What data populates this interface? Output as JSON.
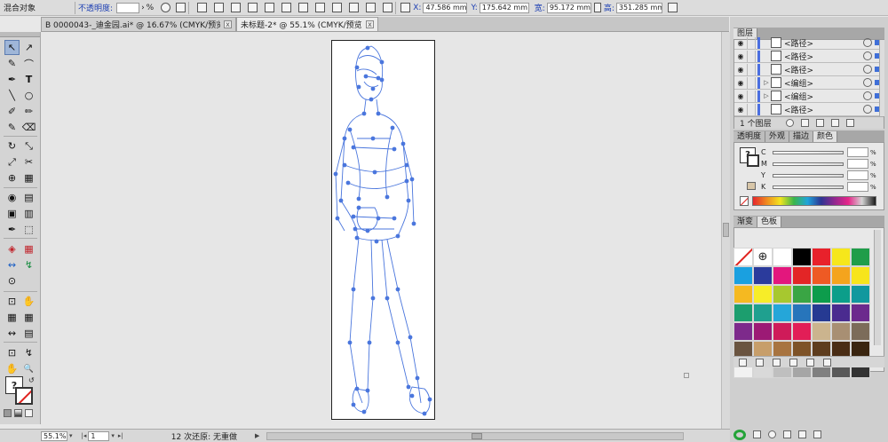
{
  "control_bar": {
    "object_type": "混合对象",
    "opacity_label": "不透明度:",
    "opacity_value": "",
    "opacity_unit": "%",
    "x_label": "X:",
    "x_value": "47.586 mm",
    "y_label": "Y:",
    "y_value": "175.642 mm",
    "w_label": "宽:",
    "w_value": "95.172 mm",
    "h_label": "高:",
    "h_value": "351.285 mm"
  },
  "tabs": [
    {
      "label": "B 0000043-_迪金园.ai* @ 16.67% (CMYK/预览)",
      "close": "x"
    },
    {
      "label": "未标题-2* @ 55.1% (CMYK/预览)",
      "close": "x"
    }
  ],
  "tools": [
    "↖",
    "↗",
    "✎",
    "⌒",
    "✒",
    "T",
    "╲",
    "○",
    "✐",
    "✏",
    "✎",
    "⌫",
    "↻",
    "⤡",
    "⤢",
    "✂",
    "⊕",
    "▦",
    "◉",
    "▤",
    "▣",
    "▥",
    "✒",
    "⬚",
    "◈",
    "▦",
    "↭",
    "↯",
    "⊙",
    "⊡",
    "✋",
    "🔍"
  ],
  "layers_panel": {
    "title": "图层",
    "rows": [
      {
        "name": "<路径>",
        "twisty": ""
      },
      {
        "name": "<路径>",
        "twisty": ""
      },
      {
        "name": "<路径>",
        "twisty": ""
      },
      {
        "name": "<编组>",
        "twisty": "▷"
      },
      {
        "name": "<编组>",
        "twisty": "▷"
      },
      {
        "name": "<路径>",
        "twisty": ""
      }
    ],
    "count_label": "1 个图层"
  },
  "color_panel": {
    "tabs": [
      "透明度",
      "外观",
      "描边",
      "颜色"
    ],
    "active_tab": "颜色",
    "channels": [
      {
        "label": "C",
        "value": "",
        "unit": "%"
      },
      {
        "label": "M",
        "value": "",
        "unit": "%"
      },
      {
        "label": "Y",
        "value": "",
        "unit": "%"
      },
      {
        "label": "K",
        "value": "",
        "unit": "%"
      }
    ]
  },
  "swatches_panel": {
    "tabs": [
      "渐变",
      "色板"
    ],
    "active_tab": "色板",
    "colors": [
      "none",
      "registration",
      "#ffffff",
      "#000000",
      "#e8212b",
      "#f6e71b",
      "#1f9d4a",
      "#1aa0e0",
      "#2b3b9c",
      "#e3177d",
      "#e32526",
      "#ee5a24",
      "#f4a41d",
      "#f7e51c",
      "#f5b921",
      "#f7ed28",
      "#a7c82f",
      "#3aa544",
      "#0d9c4c",
      "#0c9e8a",
      "#11989e",
      "#1c9e6e",
      "#1fa08f",
      "#25a6d9",
      "#2775bb",
      "#263a92",
      "#4a2b8f",
      "#6c2a8d",
      "#7d2a8b",
      "#9c1a75",
      "#cf1b59",
      "#e21e57",
      "#cbb48e",
      "#a88f73",
      "#7c6c5a",
      "#6a5440",
      "#c79e6a",
      "#a87440",
      "#7e5328",
      "#5e3d1e",
      "#4a2d15",
      "#3a2510",
      "#f2f2f2",
      "#d9d9d9",
      "#bfbfbf",
      "#a6a6a6",
      "#808080",
      "#595959",
      "#333333"
    ]
  },
  "status_bar": {
    "zoom": "55.1%",
    "page": "1",
    "status_text": "12 次还原: 无重做"
  }
}
